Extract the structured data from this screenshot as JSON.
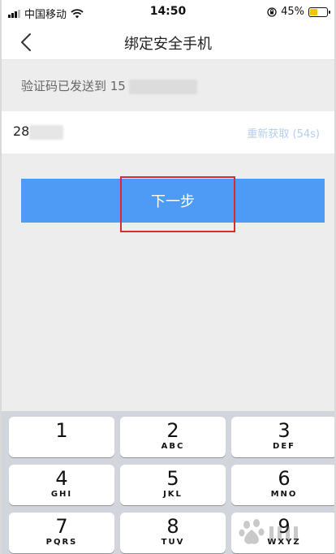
{
  "status_bar": {
    "carrier": "中国移动",
    "time": "14:50",
    "battery": "45%",
    "battery_level": 0.45
  },
  "navbar": {
    "title": "绑定安全手机"
  },
  "info": {
    "text": "验证码已发送到 15"
  },
  "code_field": {
    "value": "28",
    "resend_label": "重新获取 (54s)"
  },
  "next_button": {
    "label": "下一步"
  },
  "keyboard": {
    "keys": [
      {
        "num": "1",
        "letters": ""
      },
      {
        "num": "2",
        "letters": "ABC"
      },
      {
        "num": "3",
        "letters": "DEF"
      },
      {
        "num": "4",
        "letters": "GHI"
      },
      {
        "num": "5",
        "letters": "JKL"
      },
      {
        "num": "6",
        "letters": "MNO"
      },
      {
        "num": "7",
        "letters": "PQRS"
      },
      {
        "num": "8",
        "letters": "TUV"
      },
      {
        "num": "9",
        "letters": "WXYZ"
      }
    ]
  },
  "colors": {
    "accent": "#4d9bf5",
    "highlight": "#d92b2b",
    "resend": "#b3cdef"
  }
}
